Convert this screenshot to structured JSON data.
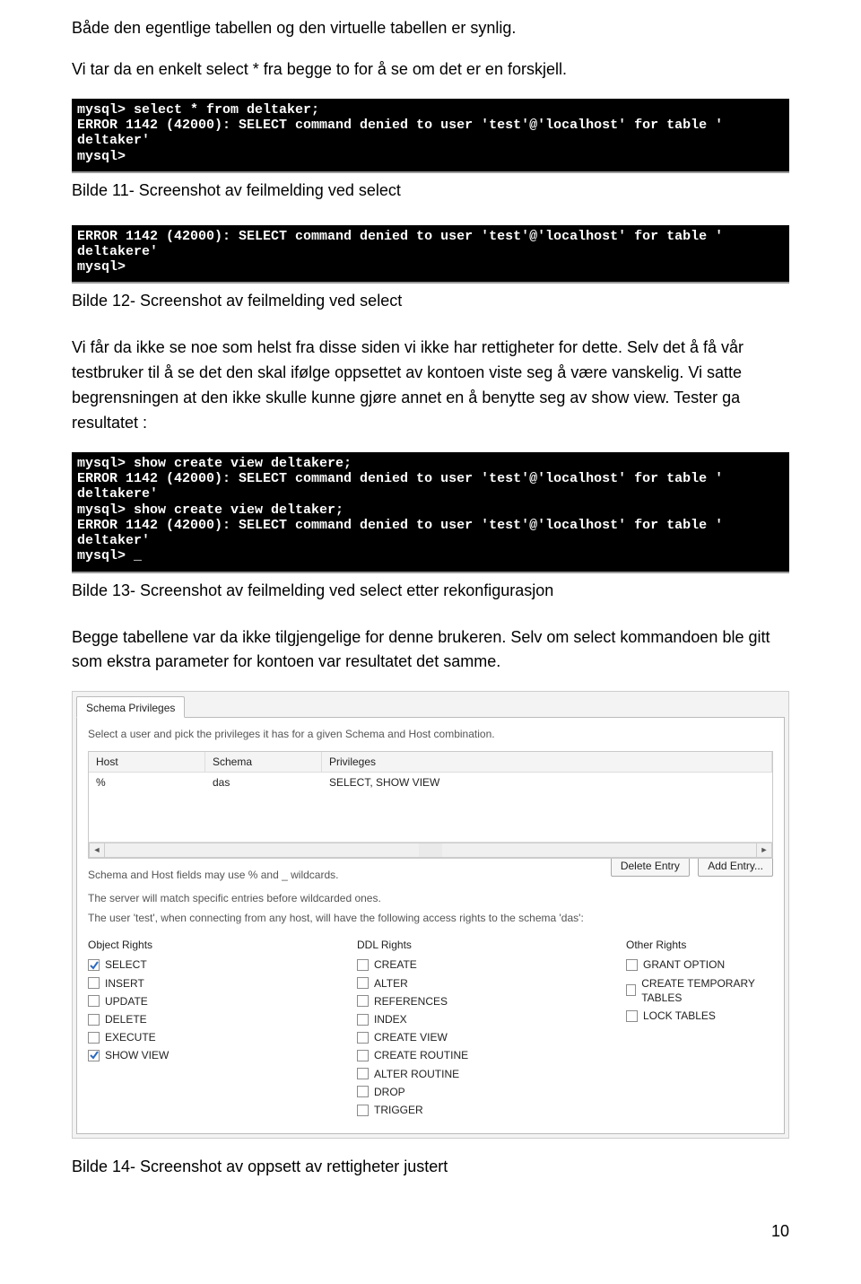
{
  "intro": {
    "p1": "Både den egentlige tabellen og den virtuelle tabellen er synlig.",
    "p2": "Vi tar da en enkelt select * fra begge to for å se om det er en forskjell."
  },
  "term1": "mysql> select * from deltaker;\nERROR 1142 (42000): SELECT command denied to user 'test'@'localhost' for table '\ndeltaker'\nmysql>",
  "cap11": "Bilde 11- Screenshot av feilmelding ved select",
  "term2": "ERROR 1142 (42000): SELECT command denied to user 'test'@'localhost' for table '\ndeltakere'\nmysql>",
  "cap12": "Bilde 12- Screenshot av feilmelding ved select",
  "mid": "Vi får da ikke se noe som helst fra disse siden vi ikke har rettigheter for dette. Selv det å få vår testbruker til å se det den skal ifølge oppsettet av kontoen viste seg å være vanskelig. Vi satte begrensningen at den ikke skulle kunne gjøre annet en å benytte seg av show view. Tester ga resultatet :",
  "term3": "mysql> show create view deltakere;\nERROR 1142 (42000): SELECT command denied to user 'test'@'localhost' for table '\ndeltakere'\nmysql> show create view deltaker;\nERROR 1142 (42000): SELECT command denied to user 'test'@'localhost' for table '\ndeltaker'\nmysql> _",
  "cap13": "Bilde 13- Screenshot av feilmelding ved select etter rekonfigurasjon",
  "after": "Begge tabellene var da ikke tilgjengelige for denne brukeren. Selv om select kommandoen ble gitt som ekstra parameter for kontoen var resultatet det samme.",
  "sp": {
    "tab": "Schema Privileges",
    "hint": "Select a user and pick the privileges it has for a given Schema and Host combination.",
    "headers": {
      "host": "Host",
      "schema": "Schema",
      "priv": "Privileges"
    },
    "row": {
      "host": "%",
      "schema": "das",
      "priv": "SELECT, SHOW VIEW"
    },
    "note1": "Schema and Host fields may use % and _ wildcards.",
    "note2": "The server will match specific entries before wildcarded ones.",
    "btn_delete": "Delete Entry",
    "btn_add": "Add Entry...",
    "desc": "The user 'test', when connecting from any host, will have the following access rights to the schema 'das':",
    "heads": {
      "obj": "Object Rights",
      "ddl": "DDL Rights",
      "oth": "Other Rights"
    },
    "obj": [
      {
        "label": "SELECT",
        "checked": true
      },
      {
        "label": "INSERT",
        "checked": false
      },
      {
        "label": "UPDATE",
        "checked": false
      },
      {
        "label": "DELETE",
        "checked": false
      },
      {
        "label": "EXECUTE",
        "checked": false
      },
      {
        "label": "SHOW VIEW",
        "checked": true
      }
    ],
    "ddl": [
      {
        "label": "CREATE",
        "checked": false
      },
      {
        "label": "ALTER",
        "checked": false
      },
      {
        "label": "REFERENCES",
        "checked": false
      },
      {
        "label": "INDEX",
        "checked": false
      },
      {
        "label": "CREATE VIEW",
        "checked": false
      },
      {
        "label": "CREATE ROUTINE",
        "checked": false
      },
      {
        "label": "ALTER ROUTINE",
        "checked": false
      },
      {
        "label": "DROP",
        "checked": false
      },
      {
        "label": "TRIGGER",
        "checked": false
      }
    ],
    "oth": [
      {
        "label": "GRANT OPTION",
        "checked": false
      },
      {
        "label": "CREATE TEMPORARY TABLES",
        "checked": false
      },
      {
        "label": "LOCK TABLES",
        "checked": false
      }
    ]
  },
  "cap14": "Bilde 14- Screenshot av oppsett av rettigheter justert",
  "page": "10"
}
